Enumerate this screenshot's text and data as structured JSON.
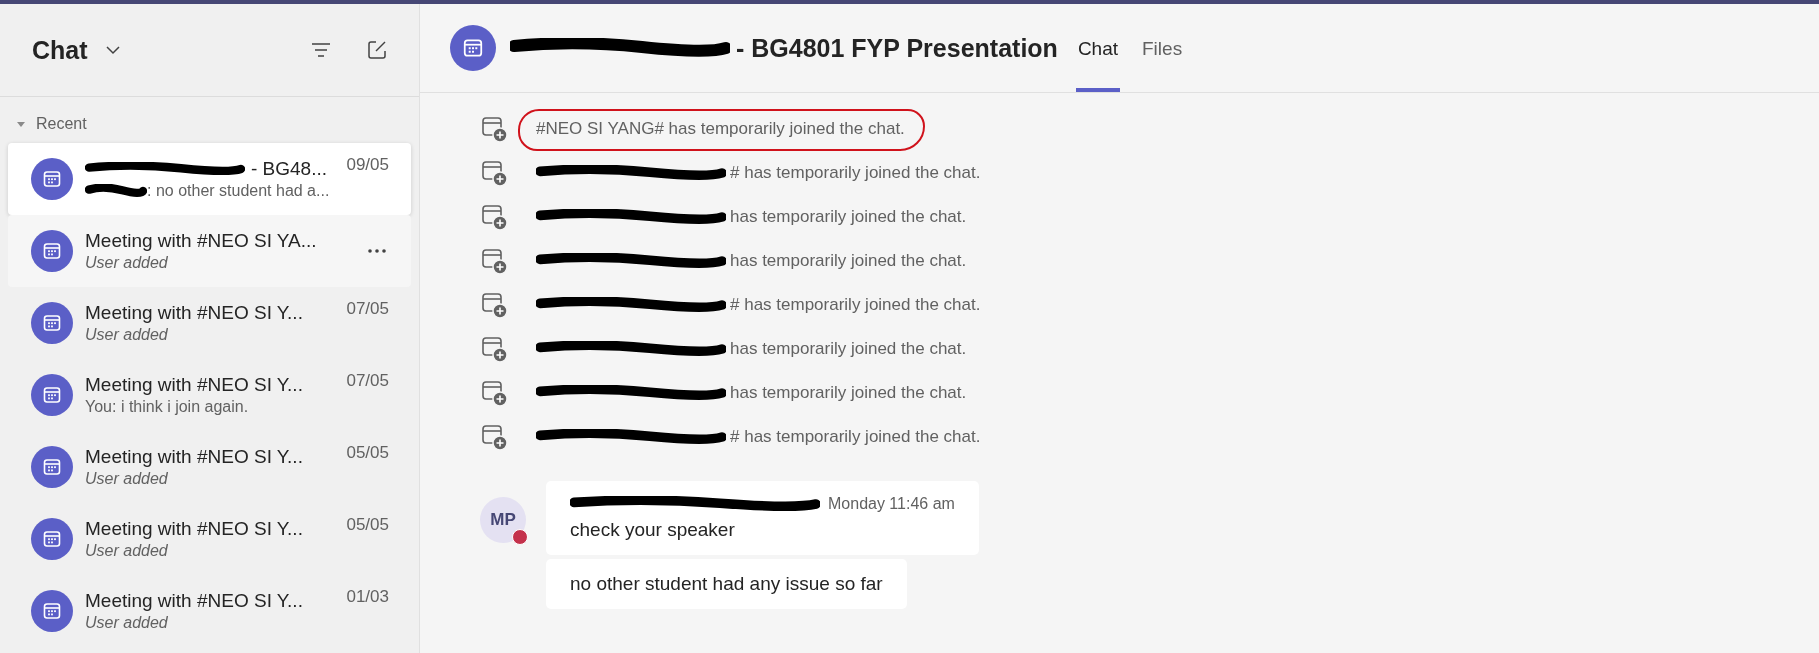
{
  "sidebar": {
    "title": "Chat",
    "section": "Recent",
    "section_expanded": true,
    "chats": [
      {
        "redacted": true,
        "title": "- BG48...",
        "date": "09/05",
        "preview_redacted": true,
        "preview": ": no other student had a...",
        "preview_italic": false,
        "selected": true,
        "hovered": false
      },
      {
        "redacted": false,
        "title": "Meeting with #NEO SI YA...",
        "preview_redacted": false,
        "preview": "User added",
        "preview_italic": true,
        "selected": false,
        "hovered": true
      },
      {
        "redacted": false,
        "title": "Meeting with #NEO SI Y...",
        "date": "07/05",
        "preview_redacted": false,
        "preview": "User added",
        "preview_italic": true,
        "selected": false,
        "hovered": false
      },
      {
        "redacted": false,
        "title": "Meeting with #NEO SI Y...",
        "date": "07/05",
        "preview_redacted": false,
        "preview": "You: i think i join again.",
        "preview_italic": false,
        "selected": false,
        "hovered": false
      },
      {
        "redacted": false,
        "title": "Meeting with #NEO SI Y...",
        "date": "05/05",
        "preview_redacted": false,
        "preview": "User added",
        "preview_italic": true,
        "selected": false,
        "hovered": false
      },
      {
        "redacted": false,
        "title": "Meeting with #NEO SI Y...",
        "date": "05/05",
        "preview_redacted": false,
        "preview": "User added",
        "preview_italic": true,
        "selected": false,
        "hovered": false
      },
      {
        "redacted": false,
        "title": "Meeting with #NEO SI Y...",
        "date": "01/03",
        "preview_redacted": false,
        "preview": "User added",
        "preview_italic": true,
        "selected": false,
        "hovered": false
      }
    ]
  },
  "header": {
    "title_redacted": true,
    "title": "- BG4801 FYP Presentation",
    "tabs": [
      {
        "label": "Chat",
        "selected": true
      },
      {
        "label": "Files",
        "selected": false
      }
    ]
  },
  "events": [
    {
      "redacted": false,
      "text": "#NEO SI YANG# has temporarily joined the chat.",
      "circled": true
    },
    {
      "redacted": true,
      "text": "# has temporarily joined the chat.",
      "circled": false
    },
    {
      "redacted": true,
      "text": "has temporarily joined the chat.",
      "circled": false
    },
    {
      "redacted": true,
      "text": "has temporarily joined the chat.",
      "circled": false
    },
    {
      "redacted": true,
      "text": "# has temporarily joined the chat.",
      "circled": false
    },
    {
      "redacted": true,
      "text": "has temporarily joined the chat.",
      "circled": false
    },
    {
      "redacted": true,
      "text": "has temporarily joined the chat.",
      "circled": false
    },
    {
      "redacted": true,
      "text": "# has temporarily joined the chat.",
      "circled": false
    }
  ],
  "message": {
    "initials": "MP",
    "busy": true,
    "sender_redacted": true,
    "time": "Monday 11:46 am",
    "bubbles": [
      "check your speaker",
      "no other student had any issue so far"
    ]
  }
}
